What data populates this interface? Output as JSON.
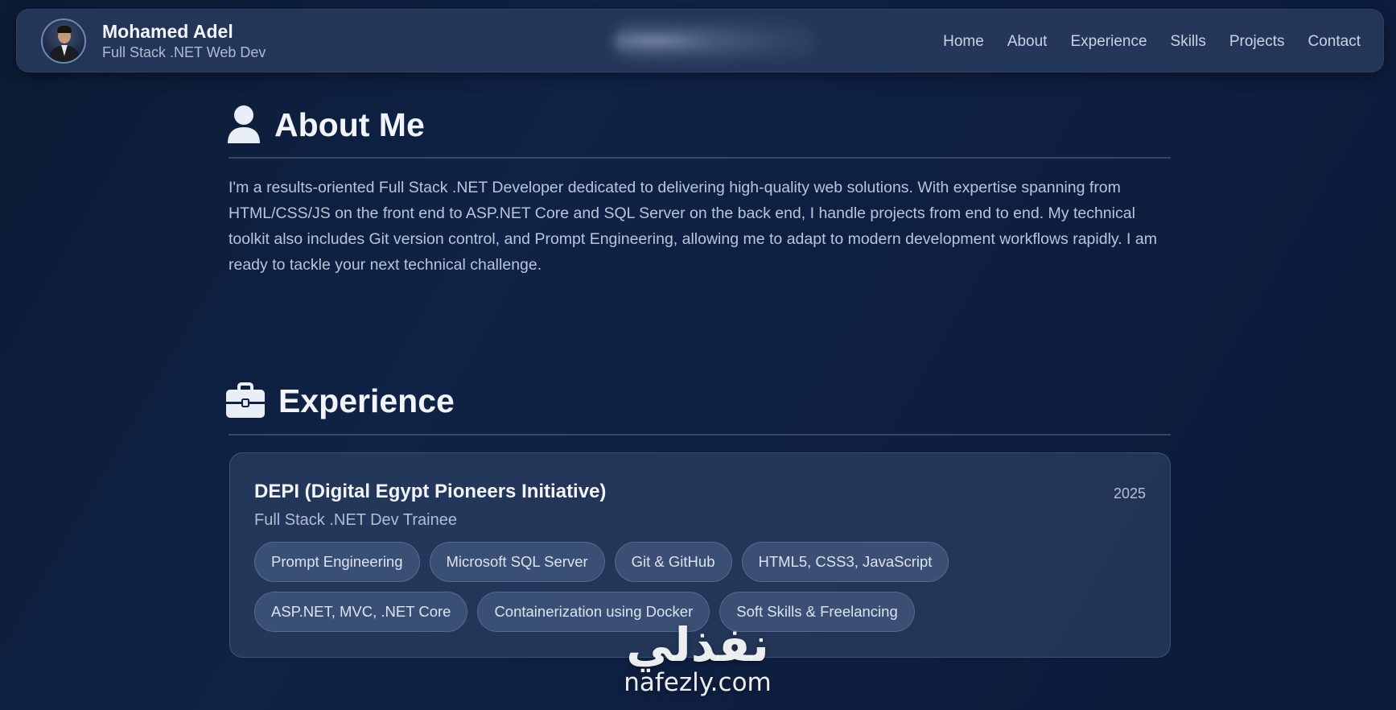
{
  "header": {
    "name": "Mohamed Adel",
    "role": "Full Stack .NET Web Dev",
    "nav": [
      "Home",
      "About",
      "Experience",
      "Skills",
      "Projects",
      "Contact"
    ]
  },
  "about": {
    "icon": "user-icon",
    "title": "About Me",
    "text": "I'm a results-oriented Full Stack .NET Developer dedicated to delivering high-quality web solutions. With expertise spanning from HTML/CSS/JS on the front end to ASP.NET Core and SQL Server on the back end, I handle projects from end to end. My technical toolkit also includes Git version control, and Prompt Engineering, allowing me to adapt to modern development workflows rapidly. I am ready to tackle your next technical challenge."
  },
  "experience": {
    "icon": "briefcase-icon",
    "title": "Experience",
    "items": [
      {
        "org": "DEPI (Digital Egypt Pioneers Initiative)",
        "year": "2025",
        "role": "Full Stack .NET Dev Trainee",
        "tags": [
          "Prompt Engineering",
          "Microsoft SQL Server",
          "Git & GitHub",
          "HTML5, CSS3, JavaScript",
          "ASP.NET, MVC, .NET Core",
          "Containerization using Docker",
          "Soft Skills & Freelancing"
        ]
      }
    ]
  },
  "watermark": {
    "arabic": "نفذلي",
    "latin": "nafezly.com"
  },
  "colors": {
    "background": "#0f2346",
    "card": "#34486c",
    "text": "#e6ecf5",
    "muted": "#b9c5d8"
  }
}
